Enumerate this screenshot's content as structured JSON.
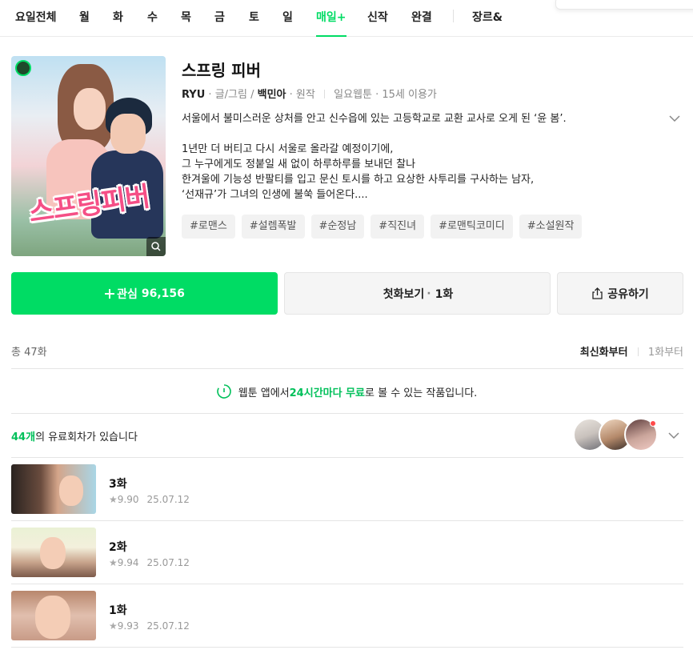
{
  "nav": {
    "items": [
      "요일전체",
      "월",
      "화",
      "수",
      "목",
      "금",
      "토",
      "일",
      "매일+",
      "신작",
      "완결",
      "장르&"
    ],
    "active": "매일+"
  },
  "series": {
    "title": "스프링 피버",
    "author": "RYU",
    "author_role": "글/그림",
    "original_author": "백민아",
    "original_role": "원작",
    "day": "일요웹툰",
    "age": "15세 이용가",
    "cover_title": "스프링피버",
    "description": [
      "서울에서 불미스러운 상처를 안고 신수읍에 있는 고등학교로 교환 교사로 오게 된 ‘윤 봄’.",
      "",
      "1년만 더 버티고 다시 서울로 올라갈 예정이기에,",
      "그 누구에게도 정붙일 새 없이 하루하루를 보내던 찰나",
      "한겨울에 기능성 반팔티를 입고 문신 토시를 하고 요상한 사투리를 구사하는 남자,",
      "‘선재규’가 그녀의 인생에 불쑥 들어온다...."
    ],
    "tags": [
      "#로맨스",
      "#설렘폭발",
      "#순정남",
      "#직진녀",
      "#로맨틱코미디",
      "#소설원작"
    ]
  },
  "actions": {
    "favorite_label": "관심",
    "favorite_count": "96,156",
    "first_label": "첫화보기",
    "first_episode": "1화",
    "share_label": "공유하기"
  },
  "list": {
    "total": "총 47화",
    "sort_latest": "최신화부터",
    "sort_first": "1화부터"
  },
  "notice": {
    "before": "웹툰 앱에서 ",
    "highlight": "24시간마다 무료",
    "after": "로 볼 수 있는 작품입니다."
  },
  "paid": {
    "count": "44개",
    "text": "의 유료회차가 있습니다"
  },
  "episodes": [
    {
      "title": "3화",
      "rating": "9.90",
      "date": "25.07.12"
    },
    {
      "title": "2화",
      "rating": "9.94",
      "date": "25.07.12"
    },
    {
      "title": "1화",
      "rating": "9.93",
      "date": "25.07.12"
    }
  ],
  "colors": {
    "accent": "#00dc64",
    "highlight_text": "#00c05a",
    "tag_bg": "#f2f2f2"
  }
}
